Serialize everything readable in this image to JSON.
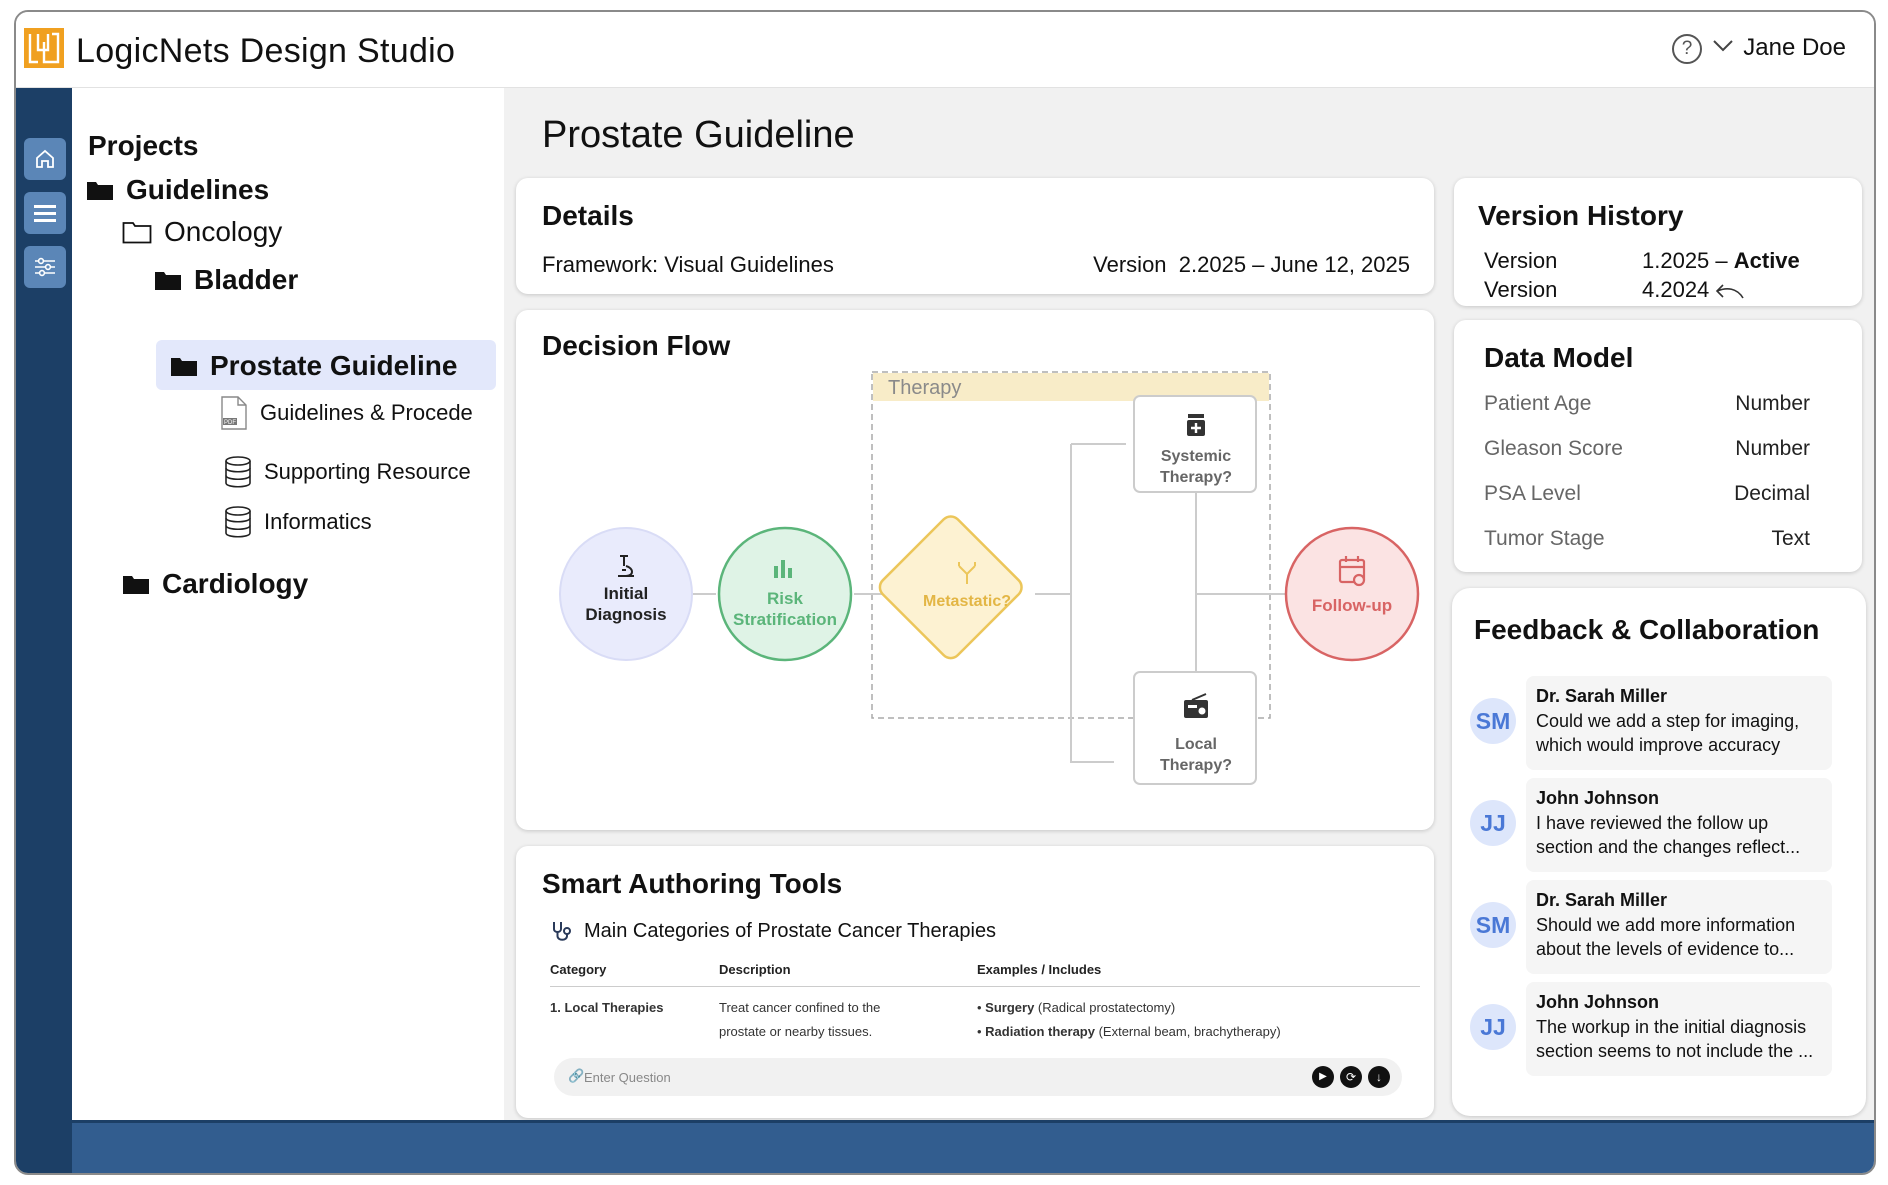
{
  "header": {
    "app_title": "LogicNets Design Studio",
    "user_name": "Jane Doe",
    "help_icon": "question-circle-icon"
  },
  "rail": {
    "items": [
      {
        "icon": "home-icon"
      },
      {
        "icon": "menu-icon"
      },
      {
        "icon": "sliders-icon"
      }
    ]
  },
  "projects": {
    "title": "Projects",
    "tree": {
      "guidelines": "Guidelines",
      "oncology": "Oncology",
      "bladder": "Bladder",
      "prostate": "Prostate Guideline",
      "guidelines_procedures": "Guidelines & Procede",
      "supporting_resource": "Supporting Resource",
      "informatics": "Informatics",
      "cardiology": "Cardiology"
    }
  },
  "main": {
    "page_title": "Prostate Guideline"
  },
  "details": {
    "title": "Details",
    "framework": "Framework: Visual Guidelines",
    "version_label": "Version",
    "version_value": "2.2025 – June 12, 2025"
  },
  "decision_flow": {
    "title": "Decision Flow",
    "group_label": "Therapy",
    "nodes": {
      "initial_line1": "Initial",
      "initial_line2": "Diagnosis",
      "risk_line1": "Risk",
      "risk_line2": "Stratification",
      "metastatic": "Metastatic?",
      "systemic_line1": "Systemic",
      "systemic_line2": "Therapy?",
      "local_line1": "Local",
      "local_line2": "Therapy?",
      "followup": "Follow-up"
    },
    "colors": {
      "initial": "#e9ebfc",
      "risk": "#dff3e6",
      "risk_stroke": "#5bb57a",
      "metastatic": "#fdf2d2",
      "metastatic_stroke": "#ecc65a",
      "followup": "#fbe3e3",
      "followup_stroke": "#d86464",
      "group_header": "#f8ecc8"
    }
  },
  "smart_tools": {
    "title": "Smart Authoring Tools",
    "subtitle": "Main Categories of Prostate Cancer Therapies",
    "columns": [
      "Category",
      "Description",
      "Examples / Includes"
    ],
    "row": {
      "category": "1. Local Therapies",
      "desc_line1": "Treat cancer confined to the",
      "desc_line2": "prostate or nearby tissues.",
      "ex1_bold": "Surgery",
      "ex1_rest": " (Radical prostatectomy)",
      "ex2_bold": "Radiation therapy",
      "ex2_rest": " (External beam, brachytherapy)"
    },
    "input_placeholder": "Enter Question"
  },
  "version_history": {
    "title": "Version History",
    "rows": [
      {
        "label": "Version",
        "value": "1.2025 – ",
        "status": "Active"
      },
      {
        "label": "Version",
        "value": "4.2024",
        "status": ""
      }
    ]
  },
  "data_model": {
    "title": "Data Model",
    "rows": [
      {
        "key": "Patient Age",
        "type": "Number"
      },
      {
        "key": "Gleason Score",
        "type": "Number"
      },
      {
        "key": "PSA Level",
        "type": "Decimal"
      },
      {
        "key": "Tumor Stage",
        "type": "Text"
      }
    ]
  },
  "feedback": {
    "title": "Feedback & Collaboration",
    "items": [
      {
        "initials": "SM",
        "name": "Dr. Sarah Miller",
        "line1": "Could we add a step for imaging,",
        "line2": "which would improve accuracy"
      },
      {
        "initials": "JJ",
        "name": "John Johnson",
        "line1": "I have reviewed the follow up",
        "line2": "section and the changes reflect..."
      },
      {
        "initials": "SM",
        "name": "Dr. Sarah Miller",
        "line1": "Should we add more information",
        "line2": "about the levels of evidence to..."
      },
      {
        "initials": "JJ",
        "name": "John Johnson",
        "line1": "The workup in the initial diagnosis",
        "line2": "section seems to not include the ..."
      }
    ]
  }
}
